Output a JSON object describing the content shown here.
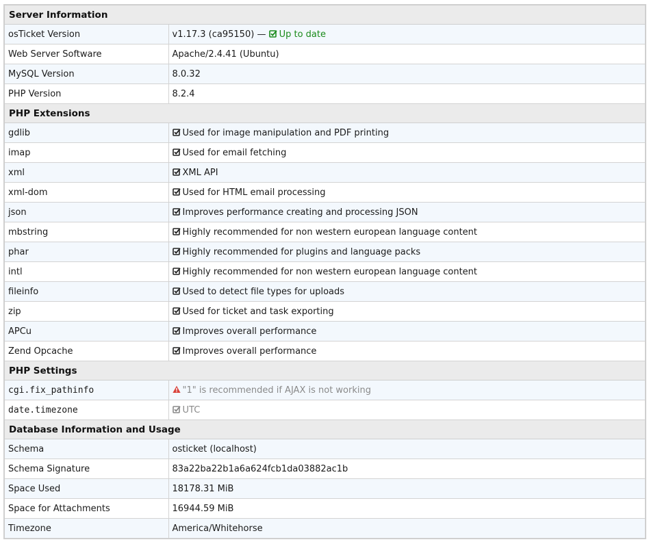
{
  "server_information": {
    "heading": "Server Information",
    "rows": [
      {
        "label": "osTicket Version",
        "value": "v1.17.3 (ca95150)",
        "separator": "—",
        "status": "Up to date"
      },
      {
        "label": "Web Server Software",
        "value": "Apache/2.4.41 (Ubuntu)"
      },
      {
        "label": "MySQL Version",
        "value": "8.0.32"
      },
      {
        "label": "PHP Version",
        "value": "8.2.4"
      }
    ]
  },
  "php_extensions": {
    "heading": "PHP Extensions",
    "rows": [
      {
        "label": "gdlib",
        "value": "Used for image manipulation and PDF printing"
      },
      {
        "label": "imap",
        "value": "Used for email fetching"
      },
      {
        "label": "xml",
        "value": "XML API"
      },
      {
        "label": "xml-dom",
        "value": "Used for HTML email processing"
      },
      {
        "label": "json",
        "value": "Improves performance creating and processing JSON"
      },
      {
        "label": "mbstring",
        "value": "Highly recommended for non western european language content"
      },
      {
        "label": "phar",
        "value": "Highly recommended for plugins and language packs"
      },
      {
        "label": "intl",
        "value": "Highly recommended for non western european language content"
      },
      {
        "label": "fileinfo",
        "value": "Used to detect file types for uploads"
      },
      {
        "label": "zip",
        "value": "Used for ticket and task exporting"
      },
      {
        "label": "APCu",
        "value": "Improves overall performance"
      },
      {
        "label": "Zend Opcache",
        "value": "Improves overall performance"
      }
    ]
  },
  "php_settings": {
    "heading": "PHP Settings",
    "rows": [
      {
        "label": "cgi.fix_pathinfo",
        "value": "\"1\" is recommended if AJAX is not working",
        "icon": "warning-icon"
      },
      {
        "label": "date.timezone",
        "value": "UTC",
        "icon": "check-square-icon"
      }
    ]
  },
  "database_information": {
    "heading": "Database Information and Usage",
    "rows": [
      {
        "label": "Schema",
        "value": "osticket (localhost)"
      },
      {
        "label": "Schema Signature",
        "value": "83a22ba22b1a6a624fcb1da03882ac1b"
      },
      {
        "label": "Space Used",
        "value": "18178.31 MiB"
      },
      {
        "label": "Space for Attachments",
        "value": "16944.59 MiB"
      },
      {
        "label": "Timezone",
        "value": "America/Whitehorse"
      }
    ]
  },
  "colors": {
    "ok_green": "#1a8a1a",
    "warning_red": "#d9413a",
    "row_tint": "#f3f8fd",
    "header_bg": "#ebebeb"
  }
}
